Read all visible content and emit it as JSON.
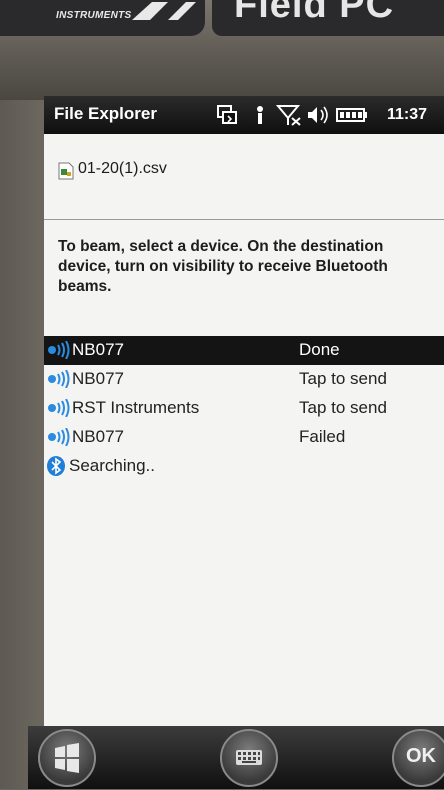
{
  "device": {
    "brand_text": "INSTRUMENTS",
    "model_text": "Field PC"
  },
  "titlebar": {
    "app_title": "File Explorer",
    "time": "11:37",
    "icons": [
      "beam-sync-icon",
      "bluetooth-person-icon",
      "no-signal-icon",
      "volume-icon",
      "battery-icon"
    ]
  },
  "file": {
    "name": "01-20(1).csv",
    "icon": "csv-file-icon"
  },
  "instructions": "To beam, select a device. On the destination device, turn on visibility to receive Bluetooth beams.",
  "devices": [
    {
      "name": "NB077",
      "status": "Done",
      "selected": true
    },
    {
      "name": "NB077",
      "status": "Tap to send",
      "selected": false
    },
    {
      "name": "RST Instruments",
      "status": "Tap to send",
      "selected": false
    },
    {
      "name": "NB077",
      "status": "Failed",
      "selected": false
    }
  ],
  "searching": {
    "label": "Searching..",
    "icon": "bluetooth-icon"
  },
  "softkeys": {
    "start_icon": "windows-start-icon",
    "keyboard_icon": "keyboard-icon",
    "ok_label": "OK"
  },
  "colors": {
    "titlebar_bg": "#141414",
    "selected_row_bg": "#141414",
    "bluetooth_blue": "#1e7ed8"
  }
}
